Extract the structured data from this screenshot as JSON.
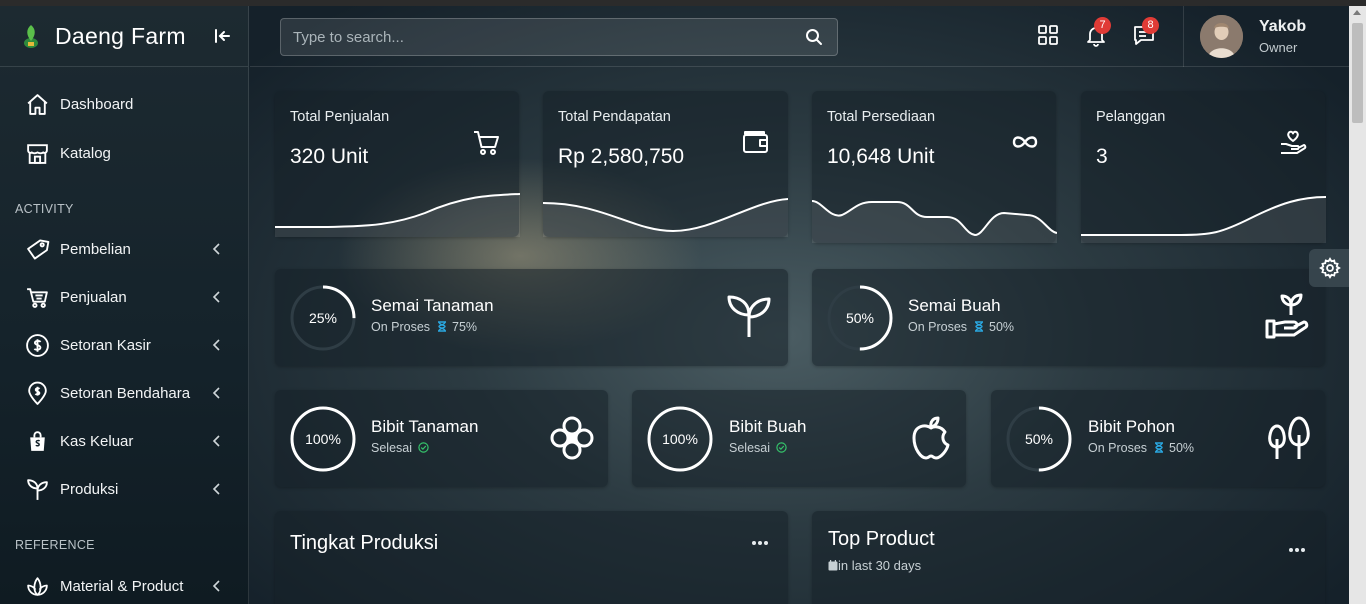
{
  "brand": {
    "name": "Daeng Farm",
    "logo_icon": "leaf-logo-icon"
  },
  "sidebar": {
    "items": [
      {
        "label": "Dashboard",
        "icon": "home-icon"
      },
      {
        "label": "Katalog",
        "icon": "store-icon"
      }
    ],
    "sections": [
      {
        "title": "ACTIVITY",
        "items": [
          {
            "label": "Pembelian",
            "icon": "tag-icon"
          },
          {
            "label": "Penjualan",
            "icon": "cart-icon"
          },
          {
            "label": "Setoran Kasir",
            "icon": "dollar-circle-icon"
          },
          {
            "label": "Setoran Bendahara",
            "icon": "location-dollar-icon"
          },
          {
            "label": "Kas Keluar",
            "icon": "shopping-bag-icon"
          },
          {
            "label": "Produksi",
            "icon": "sprout-icon"
          }
        ]
      },
      {
        "title": "REFERENCE",
        "items": [
          {
            "label": "Material & Product",
            "icon": "lotus-icon"
          }
        ]
      }
    ]
  },
  "header": {
    "search_placeholder": "Type to search...",
    "notifications_count": "7",
    "messages_count": "8",
    "user": {
      "name": "Yakob",
      "role": "Owner"
    }
  },
  "stats": [
    {
      "title": "Total Penjualan",
      "value": "320 Unit",
      "icon": "cart-icon"
    },
    {
      "title": "Total Pendapatan",
      "value": "Rp 2,580,750",
      "icon": "wallet-icon"
    },
    {
      "title": "Total Persediaan",
      "value": "10,648 Unit",
      "icon": "infinity-icon"
    },
    {
      "title": "Pelanggan",
      "value": "3",
      "icon": "hand-heart-icon"
    }
  ],
  "progress": [
    {
      "title": "Semai Tanaman",
      "status": "On Proses",
      "status_value": "75%",
      "percent": 25,
      "percent_label": "25%",
      "icon": "sprout-icon"
    },
    {
      "title": "Semai Buah",
      "status": "On Proses",
      "status_value": "50%",
      "percent": 50,
      "percent_label": "50%",
      "icon": "plant-hand-icon"
    },
    {
      "title": "Bibit Tanaman",
      "status": "Selesai",
      "status_value": "",
      "percent": 100,
      "percent_label": "100%",
      "icon": "flower-icon"
    },
    {
      "title": "Bibit Buah",
      "status": "Selesai",
      "status_value": "",
      "percent": 100,
      "percent_label": "100%",
      "icon": "apple-icon"
    },
    {
      "title": "Bibit Pohon",
      "status": "On Proses",
      "status_value": "50%",
      "percent": 50,
      "percent_label": "50%",
      "icon": "trees-icon"
    }
  ],
  "panels": {
    "production": {
      "title": "Tingkat Produksi"
    },
    "top_product": {
      "title": "Top Product",
      "subtitle": "in last 30 days"
    }
  },
  "colors": {
    "accent": "#2aa7e0",
    "badge": "#e03b36",
    "success": "#35c46b"
  }
}
